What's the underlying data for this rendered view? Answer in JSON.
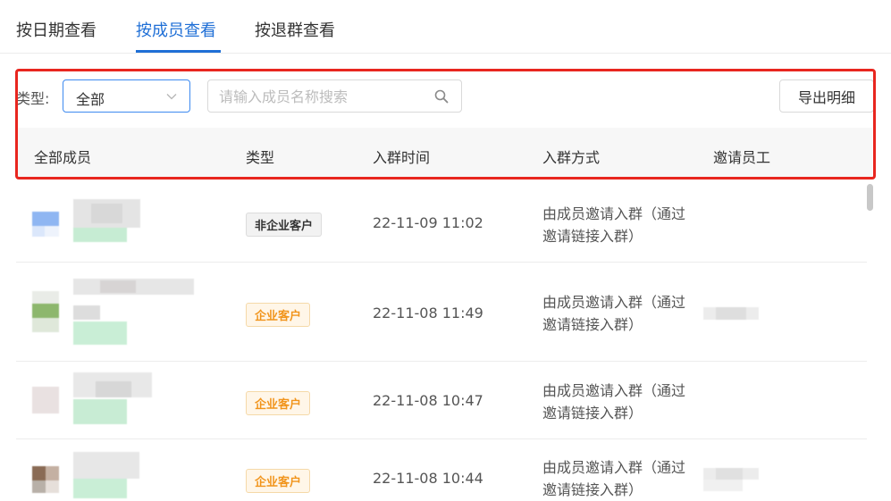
{
  "tabs": [
    {
      "label": "按日期查看",
      "active": false
    },
    {
      "label": "按成员查看",
      "active": true
    },
    {
      "label": "按退群查看",
      "active": false
    }
  ],
  "filter": {
    "type_label": "类型:",
    "type_selected": "全部",
    "search_placeholder": "请输入成员名称搜索",
    "export_label": "导出明细"
  },
  "table": {
    "headers": [
      "全部成员",
      "类型",
      "入群时间",
      "入群方式",
      "邀请员工"
    ],
    "rows": [
      {
        "type": "非企业客户",
        "time": "22-11-09 11:02",
        "method": "由成员邀请入群（通过邀请链接入群）"
      },
      {
        "type": "企业客户",
        "time": "22-11-08 11:49",
        "method": "由成员邀请入群（通过邀请链接入群）"
      },
      {
        "type": "企业客户",
        "time": "22-11-08 10:47",
        "method": "由成员邀请入群（通过邀请链接入群）"
      },
      {
        "type": "企业客户",
        "time": "22-11-08 10:44",
        "method": "由成员邀请入群（通过邀请链接入群）"
      }
    ]
  },
  "colors": {
    "accent": "#1f6fd6",
    "highlight": "#e8261f",
    "enterprise_badge": "#f1941b"
  }
}
